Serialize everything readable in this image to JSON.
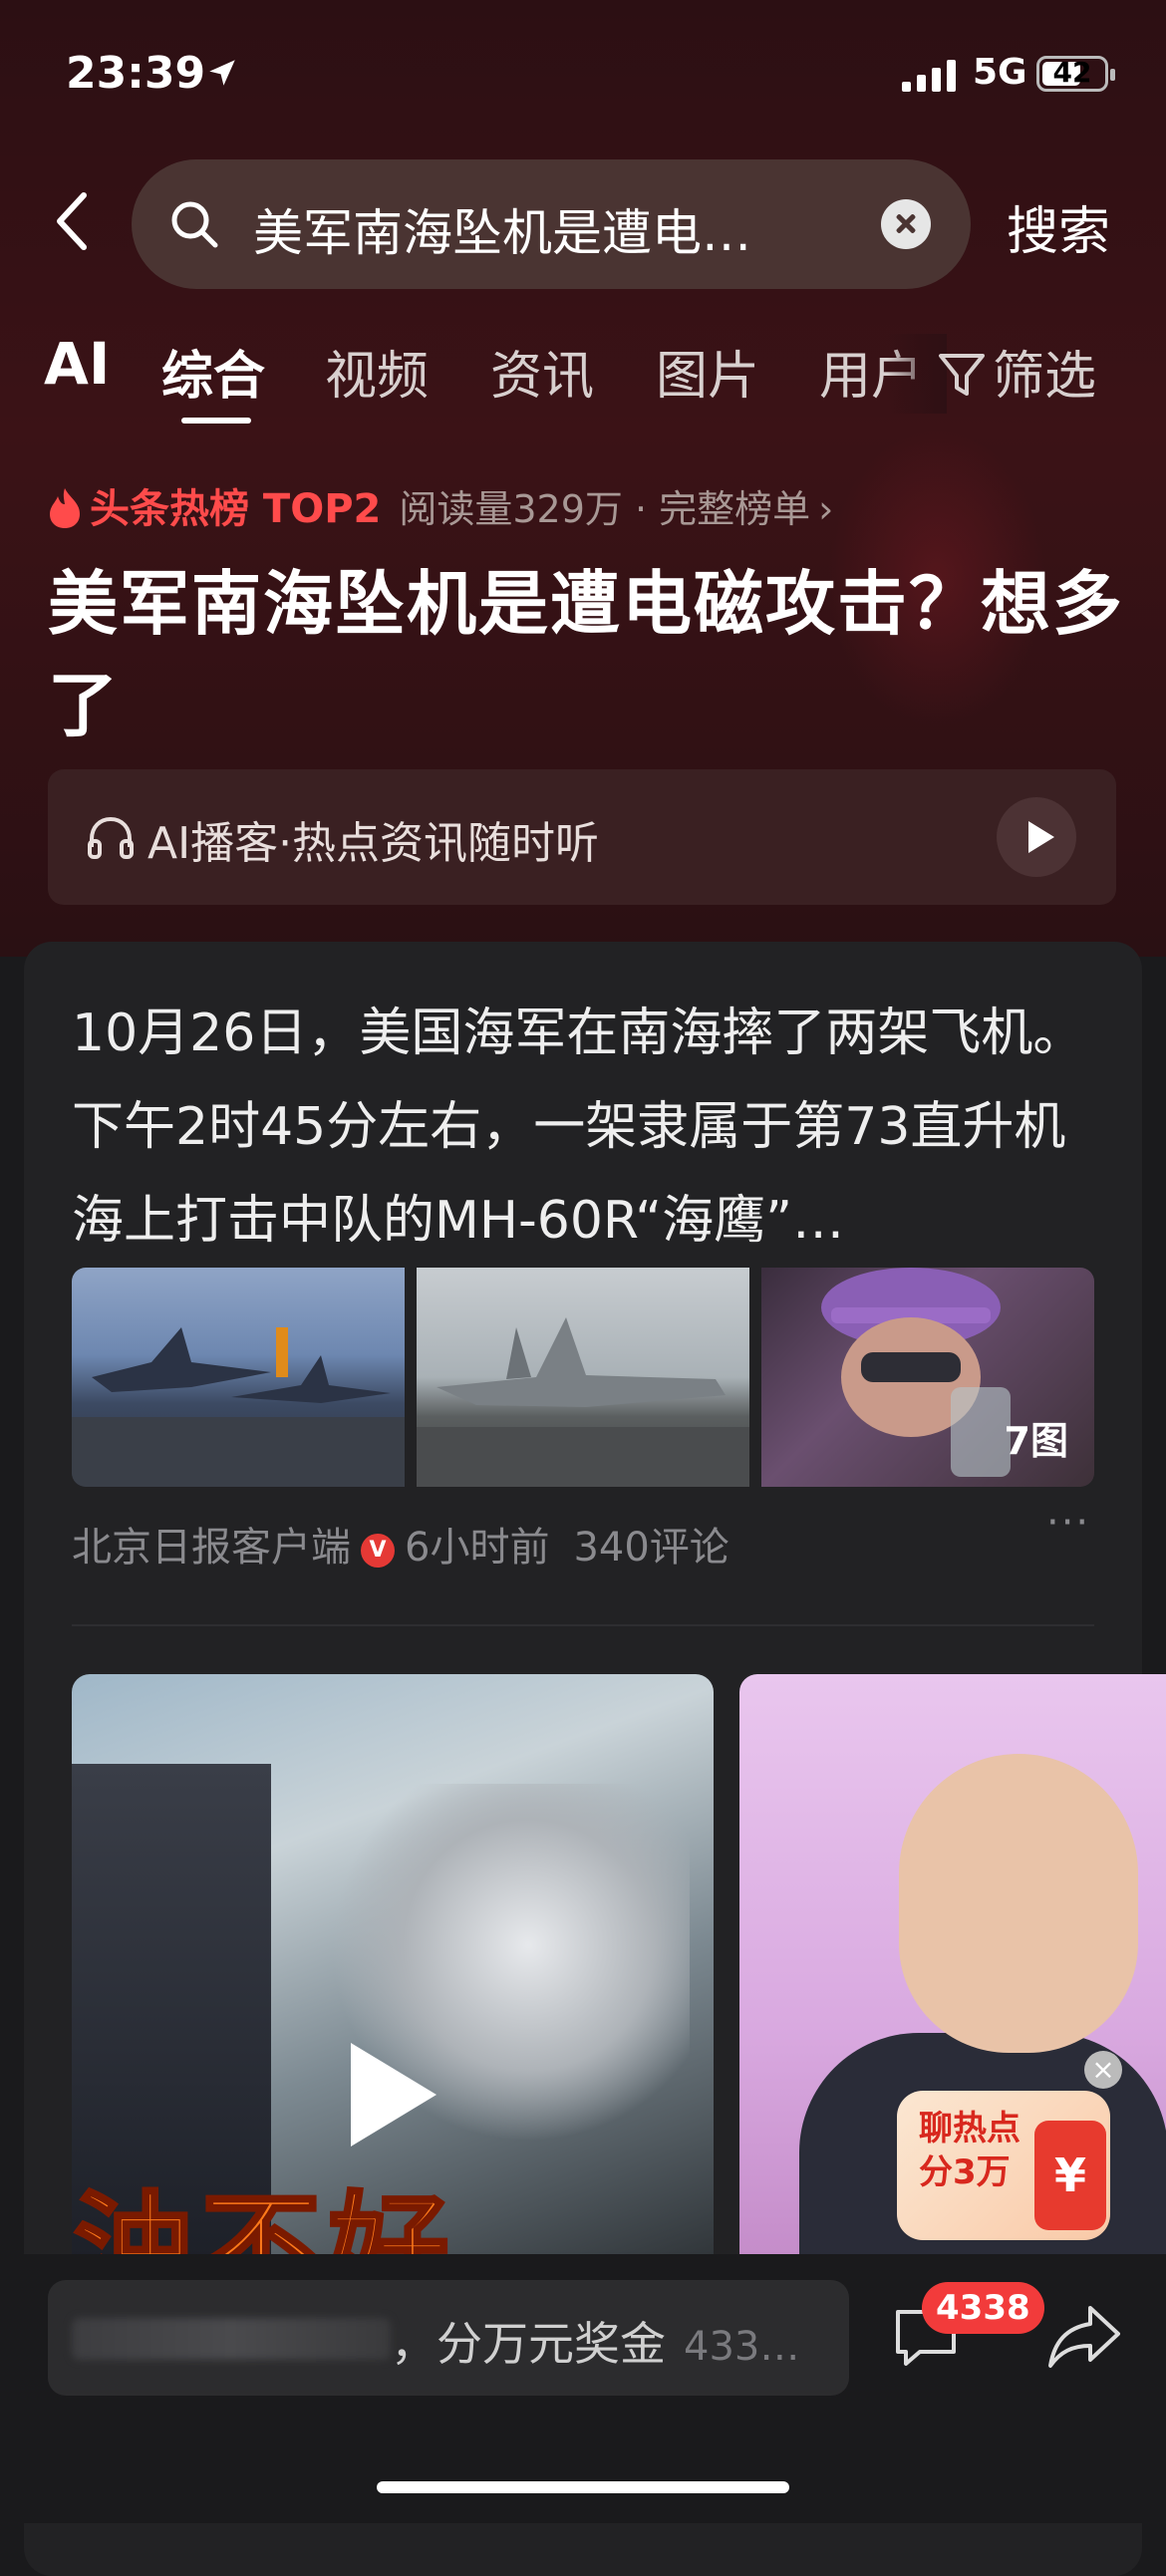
{
  "status_bar": {
    "time": "23:39",
    "network": "5G",
    "battery": "42"
  },
  "search": {
    "query": "美军南海坠机是遭电…",
    "submit_label": "搜索"
  },
  "tabs": {
    "ai": "AI",
    "items": [
      "综合",
      "视频",
      "资讯",
      "图片",
      "用户"
    ],
    "active": "综合",
    "filter_label": "筛选"
  },
  "hot": {
    "label": "头条热榜 TOP2",
    "meta": "阅读量329万 · 完整榜单",
    "chevron": "›"
  },
  "headline": "美军南海坠机是遭电磁攻击？想多了",
  "podcast": {
    "text": "AI播客·热点资讯随时听"
  },
  "article": {
    "text": "10月26日，美国海军在南海摔了两架飞机。下午2时45分左右，一架隶属于第73直升机海上打击中队的MH-60R“海鹰”…",
    "image_count": "7图",
    "source": "北京日报客户端",
    "verified": "V",
    "time": "6小时前",
    "comments": "340评论",
    "more": "···"
  },
  "video": {
    "caption": "油不好"
  },
  "promo": {
    "text_line1": "聊热点",
    "text_line2": "分3万",
    "coin": "¥",
    "close": "×"
  },
  "bottom": {
    "comment_text": "，分万元奖金",
    "comment_count": "433…",
    "badge": "4338"
  }
}
